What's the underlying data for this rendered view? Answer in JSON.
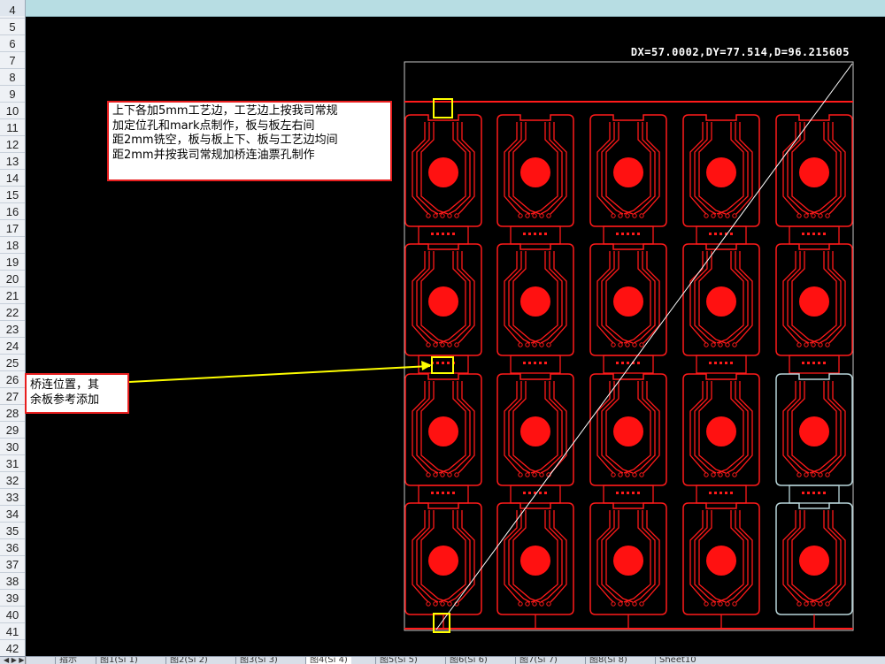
{
  "row_numbers": [
    "4",
    "5",
    "6",
    "7",
    "8",
    "9",
    "10",
    "11",
    "12",
    "13",
    "14",
    "15",
    "16",
    "17",
    "18",
    "19",
    "20",
    "21",
    "22",
    "23",
    "24",
    "25",
    "26",
    "27",
    "28",
    "29",
    "30",
    "31",
    "32",
    "33",
    "34",
    "35",
    "36",
    "37",
    "38",
    "39",
    "40",
    "41",
    "42"
  ],
  "measurement": "DX=57.0002,DY=77.514,D=96.215605",
  "notes": {
    "top": {
      "lines": [
        "上下各加5mm工艺边，工艺边上按我司常规",
        "加定位孔和mark点制作，板与板左右间",
        "距2mm铣空，板与板上下、板与工艺边均间",
        "距2mm并按我司常规加桥连油票孔制作"
      ]
    },
    "bridge": {
      "lines": [
        "桥连位置，其",
        "余板参考添加"
      ]
    }
  },
  "colors": {
    "trace": "#ff1a1a",
    "outline": "#c8c8c8",
    "highlight": "#ffff00",
    "arrow": "#ffff00",
    "note_border": "#e81f1f",
    "alt_board": "#b8d6da"
  },
  "tabs": {
    "navigation": "◀ ▶ ▶|",
    "items": [
      "指示",
      "图1(Si 1)",
      "图2(Si 2)",
      "图3(Si 3)",
      "图4(Si 4)",
      "图5(Si 5)",
      "图6(Si 6)",
      "图7(Si 7)",
      "图8(Si 8)",
      "Sheet10"
    ],
    "active_index": 4
  },
  "icons": [
    "tab-nav-first-icon",
    "tab-nav-next-icon",
    "tab-nav-last-icon"
  ]
}
